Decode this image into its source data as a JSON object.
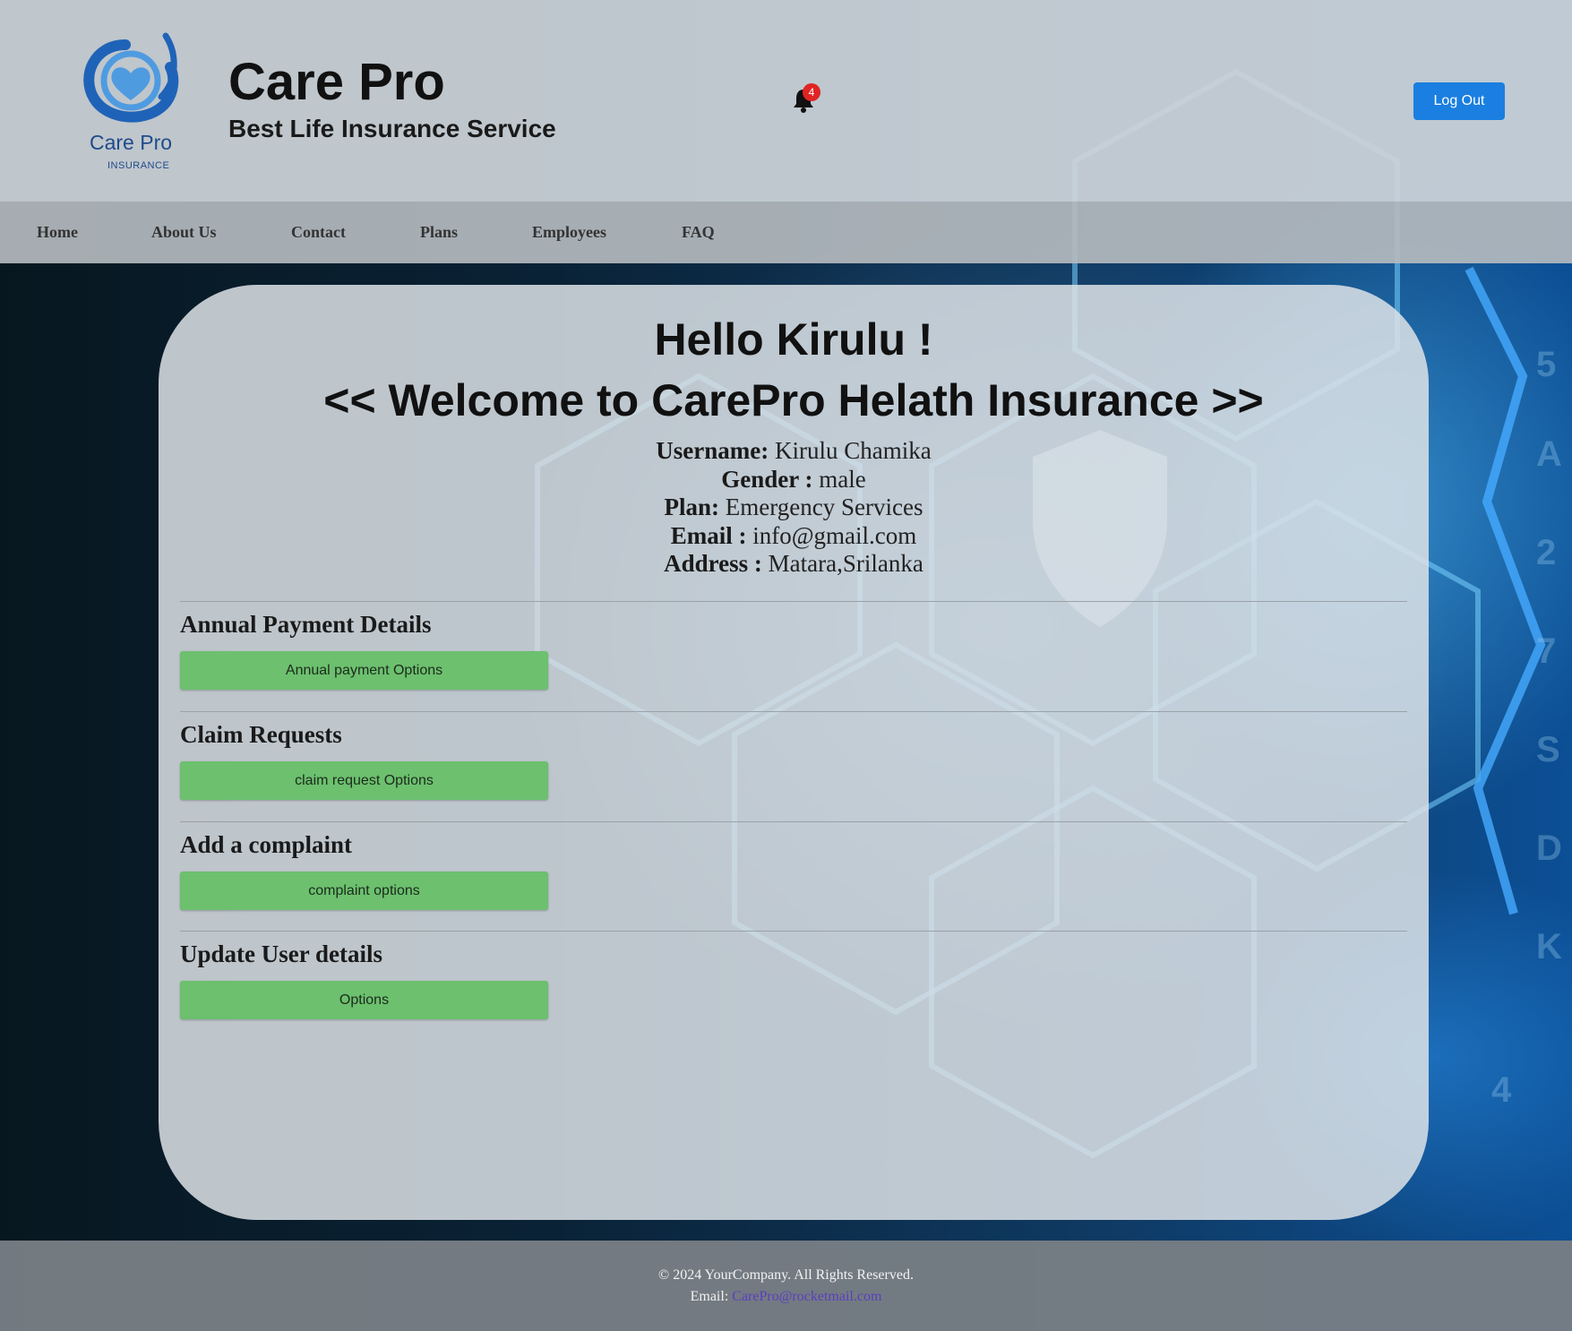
{
  "header": {
    "logo_text": "Care Pro",
    "logo_subtext": "INSURANCE",
    "title": "Care Pro",
    "tagline": "Best Life Insurance Service",
    "notification_count": "4",
    "logout_label": "Log Out",
    "icons": {
      "logo": "care-pro-heart-logo",
      "notifications": "bell-icon"
    }
  },
  "nav": {
    "items": [
      {
        "label": "Home"
      },
      {
        "label": "About Us"
      },
      {
        "label": "Contact"
      },
      {
        "label": "Plans"
      },
      {
        "label": "Employees"
      },
      {
        "label": "FAQ"
      }
    ]
  },
  "main": {
    "greeting": "Hello Kirulu !",
    "welcome": "<< Welcome to CarePro Helath Insurance >>",
    "profile": {
      "username_label": "Username:",
      "username": "Kirulu Chamika",
      "gender_label": "Gender :",
      "gender": "male",
      "plan_label": "Plan:",
      "plan": "Emergency Services",
      "email_label": "Email :",
      "email": "info@gmail.com",
      "address_label": "Address :",
      "address": "Matara,Srilanka"
    },
    "sections": [
      {
        "title": "Annual Payment Details",
        "button": "Annual payment Options"
      },
      {
        "title": "Claim Requests",
        "button": "claim request Options"
      },
      {
        "title": "Add a complaint",
        "button": "complaint options"
      },
      {
        "title": "Update User details",
        "button": "Options"
      }
    ]
  },
  "footer": {
    "copyright": "© 2024 YourCompany. All Rights Reserved.",
    "email_label": "Email:",
    "email": "CarePro@rocketmail.com"
  },
  "colors": {
    "accent_button": "#1a7fe0",
    "option_button": "#6cc06e",
    "badge": "#e02424",
    "logo_blue": "#1f4b8a"
  }
}
